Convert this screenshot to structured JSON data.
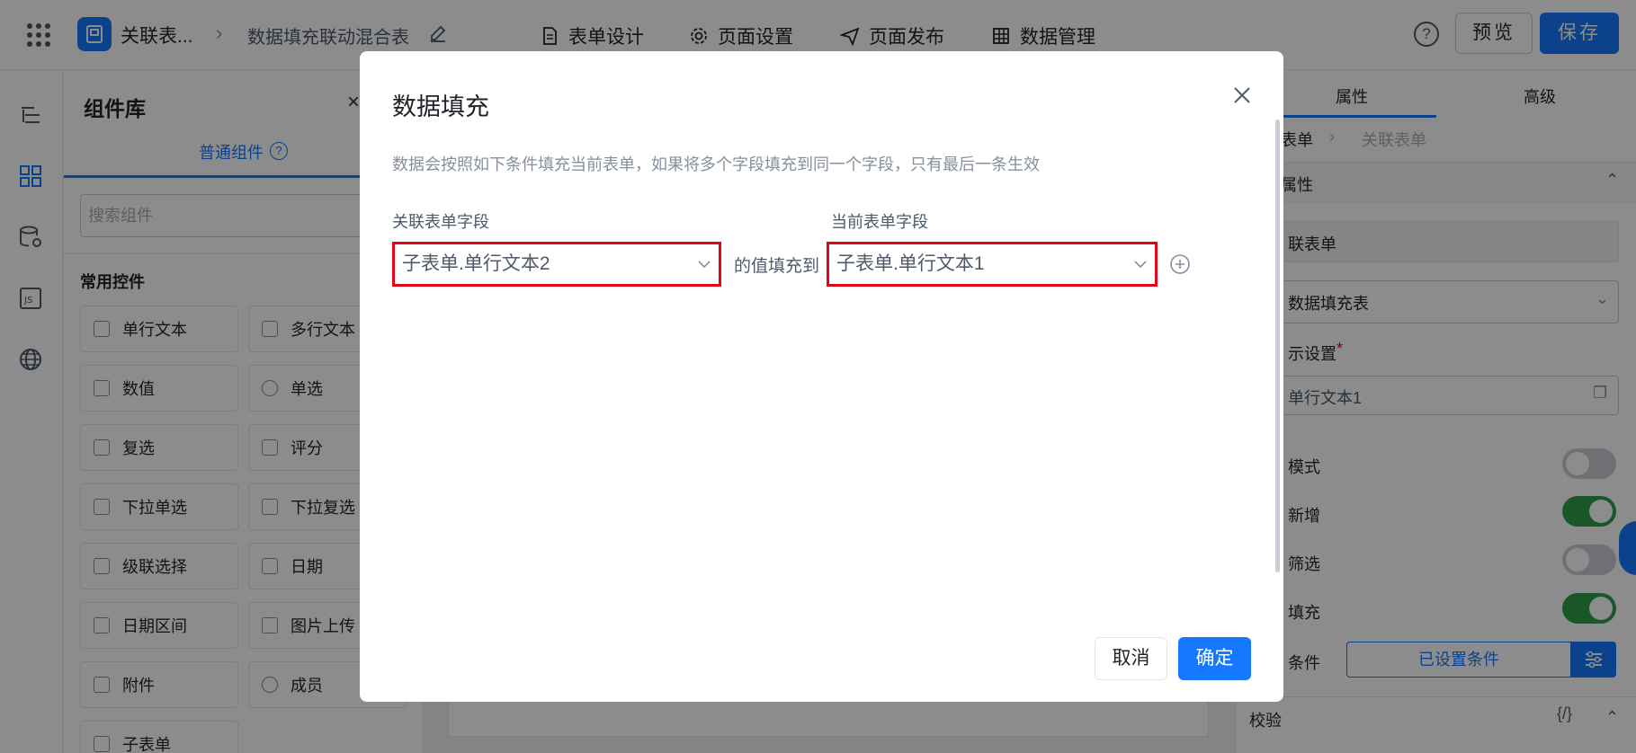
{
  "topbar": {
    "app_name": "关联表...",
    "form_name": "数据填充联动混合表",
    "tabs": [
      "表单设计",
      "页面设置",
      "页面发布",
      "数据管理"
    ],
    "help_label": "?",
    "preview_label": "预览",
    "save_label": "保存"
  },
  "complib": {
    "title": "组件库",
    "close": "×",
    "tab_label": "普通组件",
    "tab_help": "?",
    "search_placeholder": "搜索组件",
    "section_label": "常用控件",
    "items": [
      "单行文本",
      "多行文本",
      "数值",
      "单选",
      "复选",
      "评分",
      "下拉单选",
      "下拉复选",
      "级联选择",
      "日期",
      "日期区间",
      "图片上传",
      "附件",
      "成员",
      "子表单"
    ]
  },
  "props": {
    "tab_attr": "属性",
    "tab_adv": "高级",
    "crumb_1": "表单",
    "crumb_2": "关联表单",
    "section_label": "属性",
    "row_1": "联表单",
    "select_value": "数据填充表",
    "display_label": "示设置",
    "required_mark": "*",
    "display_value": "单行文本1",
    "toggle_1_label": "模式",
    "toggle_2_label": "新增",
    "toggle_3_label": "筛选",
    "toggle_4_label": "填充",
    "cond_label": "条件",
    "cond_button": "已设置条件",
    "verify_label": "校验",
    "verify_code": "{/}"
  },
  "modal": {
    "title": "数据填充",
    "description": "数据会按照如下条件填充当前表单，如果将多个字段填充到同一个字段，只有最后一条生效",
    "left_label": "关联表单字段",
    "right_label": "当前表单字段",
    "left_value": "子表单.单行文本2",
    "fill_to": "的值填充到",
    "right_value": "子表单.单行文本1",
    "cancel_label": "取消",
    "ok_label": "确定"
  },
  "colors": {
    "primary": "#1677ff",
    "highlight_border": "#e0061a",
    "toggle_on": "#2e9e4a"
  }
}
